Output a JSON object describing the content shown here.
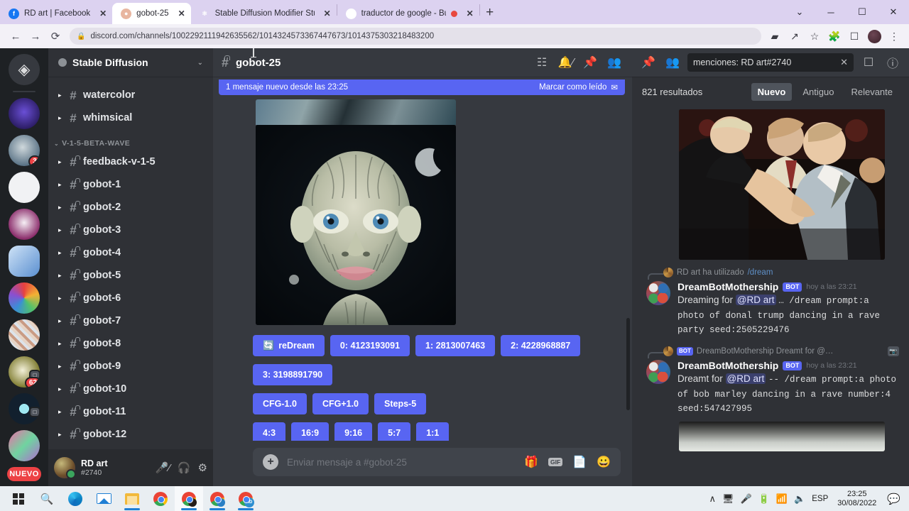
{
  "browser": {
    "tabs": [
      {
        "title": "RD art | Facebook",
        "favicon": "facebook-icon",
        "active": false,
        "recording": false
      },
      {
        "title": "gobot-25",
        "favicon": "discord-icon",
        "active": true,
        "recording": false
      },
      {
        "title": "Stable Diffusion Modifier Studie:",
        "favicon": "sd-icon",
        "active": false,
        "recording": false
      },
      {
        "title": "traductor de google - Busca",
        "favicon": "google-icon",
        "active": false,
        "recording": true
      }
    ],
    "new_tab_label": "+",
    "window_controls": {
      "chevron": "⌄",
      "minimize": "─",
      "maximize": "☐",
      "close": "✕"
    },
    "nav": {
      "back": "←",
      "forward": "→",
      "reload": "⟳"
    },
    "url": "discord.com/channels/1002292111942635562/1014324573367447673/1014375303218483200",
    "lock_icon": "lock-icon",
    "toolbar_icons": [
      "media-cast-icon",
      "share-icon",
      "bookmark-star-icon",
      "extensions-puzzle-icon",
      "sidepanel-icon",
      "profile-avatar",
      "kebab-menu-icon"
    ]
  },
  "discord": {
    "servers": [
      {
        "name": "discord-home",
        "badge": null
      },
      {
        "name": "server-purple-figure",
        "badge": null
      },
      {
        "name": "server-alien-art",
        "badge": "3"
      },
      {
        "name": "server-towards-knowledge",
        "badge": null
      },
      {
        "name": "server-crown-art",
        "badge": null
      },
      {
        "name": "server-blue-window",
        "badge": null
      },
      {
        "name": "server-rainbow-eye",
        "badge": null
      },
      {
        "name": "server-collage",
        "badge": null
      },
      {
        "name": "server-star-gold",
        "badge": "62"
      },
      {
        "name": "server-magenta-c",
        "badge": null
      },
      {
        "name": "server-pink-art",
        "badge": null
      }
    ],
    "new_pill_label": "NUEVO",
    "guild": {
      "name": "Stable Diffusion",
      "chevron": "⌄"
    },
    "channels_top": [
      {
        "name": "watercolor",
        "locked": false
      },
      {
        "name": "whimsical",
        "locked": false
      }
    ],
    "category": {
      "label": "V-1-5-BETA-WAVE",
      "chevron": "⌄"
    },
    "channels": [
      {
        "name": "feedback-v-1-5",
        "locked": true
      },
      {
        "name": "gobot-1",
        "locked": true
      },
      {
        "name": "gobot-2",
        "locked": true
      },
      {
        "name": "gobot-3",
        "locked": true
      },
      {
        "name": "gobot-4",
        "locked": true
      },
      {
        "name": "gobot-5",
        "locked": true
      },
      {
        "name": "gobot-6",
        "locked": true
      },
      {
        "name": "gobot-7",
        "locked": true
      },
      {
        "name": "gobot-8",
        "locked": true
      },
      {
        "name": "gobot-9",
        "locked": true
      },
      {
        "name": "gobot-10",
        "locked": true
      },
      {
        "name": "gobot-11",
        "locked": true
      },
      {
        "name": "gobot-12",
        "locked": true
      }
    ],
    "user_panel": {
      "name": "RD art",
      "tag": "#2740",
      "mic_icon": "microphone-muted-icon",
      "headset_icon": "headset-icon",
      "settings_icon": "gear-icon"
    },
    "chat": {
      "channel_title": "gobot-25",
      "header_icons": [
        "threads-icon",
        "notifications-off-icon",
        "pinned-messages-icon",
        "member-list-icon"
      ],
      "banner": {
        "text": "1 mensaje nuevo desde las 23:25",
        "action": "Marcar como leído",
        "action_icon": "mark-read-icon"
      },
      "buttons": [
        [
          {
            "label": "reDream",
            "icon": "🔄"
          },
          {
            "label": "0: 4123193091",
            "icon": null
          },
          {
            "label": "1: 2813007463",
            "icon": null
          },
          {
            "label": "2: 4228968887",
            "icon": null
          }
        ],
        [
          {
            "label": "3: 3198891790",
            "icon": null
          }
        ],
        [
          {
            "label": "CFG-1.0",
            "icon": null
          },
          {
            "label": "CFG+1.0",
            "icon": null
          },
          {
            "label": "Steps-5",
            "icon": null
          }
        ],
        [
          {
            "label": "4:3",
            "icon": null
          },
          {
            "label": "16:9",
            "icon": null
          },
          {
            "label": "9:16",
            "icon": null
          },
          {
            "label": "5:7",
            "icon": null
          },
          {
            "label": "1:1",
            "icon": null
          }
        ]
      ],
      "composer": {
        "placeholder": "Enviar mensaje a #gobot-25",
        "plus_icon": "plus-icon",
        "icons": [
          "gift-icon",
          "gif-icon",
          "sticker-icon",
          "emoji-icon"
        ],
        "gif_label": "GIF"
      }
    },
    "search": {
      "query": "menciones: RD art#2740",
      "clear_icon": "close-icon",
      "inbox_icon": "inbox-icon",
      "help_icon": "help-icon",
      "results_count": "821 resultados",
      "tabs": [
        {
          "label": "Nuevo",
          "active": true
        },
        {
          "label": "Antiguo",
          "active": false
        },
        {
          "label": "Relevante",
          "active": false
        }
      ],
      "results": [
        {
          "context": {
            "avatar": "rd-art-avatar",
            "text": "RD art ha utilizado",
            "link": "/dream",
            "bot": false,
            "image_chip": false
          },
          "author": "DreamBotMothership",
          "bot_tag": "BOT",
          "timestamp": "hoy a las 23:21",
          "text_lead": "Dreaming for",
          "mention": "@RD art",
          "text_rest": "… /dream prompt:a photo of donal trump dancing in a rave party seed:2505229476"
        },
        {
          "context": {
            "avatar": "bot-avatar",
            "text": "DreamBotMothership Dreamt for @…",
            "link": "",
            "bot": true,
            "bot_tag": "BOT",
            "image_chip": true
          },
          "author": "DreamBotMothership",
          "bot_tag": "BOT",
          "timestamp": "hoy a las 23:21",
          "text_lead": "Dreamt for",
          "mention": "@RD art",
          "text_rest": " -- /dream prompt:a photo of bob marley dancing in a rave number:4 seed:547427995"
        }
      ]
    }
  },
  "taskbar": {
    "start_label": "start-button",
    "items": [
      {
        "name": "search-icon",
        "running": false,
        "focused": false
      },
      {
        "name": "edge-icon",
        "running": false,
        "focused": false
      },
      {
        "name": "mail-icon",
        "running": false,
        "focused": false
      },
      {
        "name": "file-explorer-icon",
        "running": true,
        "focused": false
      },
      {
        "name": "chrome-icon",
        "running": false,
        "focused": false
      },
      {
        "name": "chrome-window-dark-icon",
        "running": true,
        "focused": true
      },
      {
        "name": "chrome-window-blue-icon",
        "running": true,
        "focused": false
      },
      {
        "name": "chrome-window-rd-icon",
        "running": true,
        "focused": false
      }
    ],
    "tray": {
      "chevron": "∧",
      "icons": [
        "screen-share-icon",
        "microphone-icon",
        "battery-icon",
        "wifi-icon",
        "volume-icon"
      ],
      "language": "ESP",
      "time": "23:25",
      "date": "30/08/2022",
      "notification_icon": "notification-icon"
    }
  },
  "colors": {
    "discord_blurple": "#5865f2",
    "discord_dark": "#36393f",
    "discord_sidebar": "#2f3136",
    "discord_rail": "#1e2124",
    "red_badge": "#ed4245",
    "browser_tabbar": "#dcd2f0"
  }
}
